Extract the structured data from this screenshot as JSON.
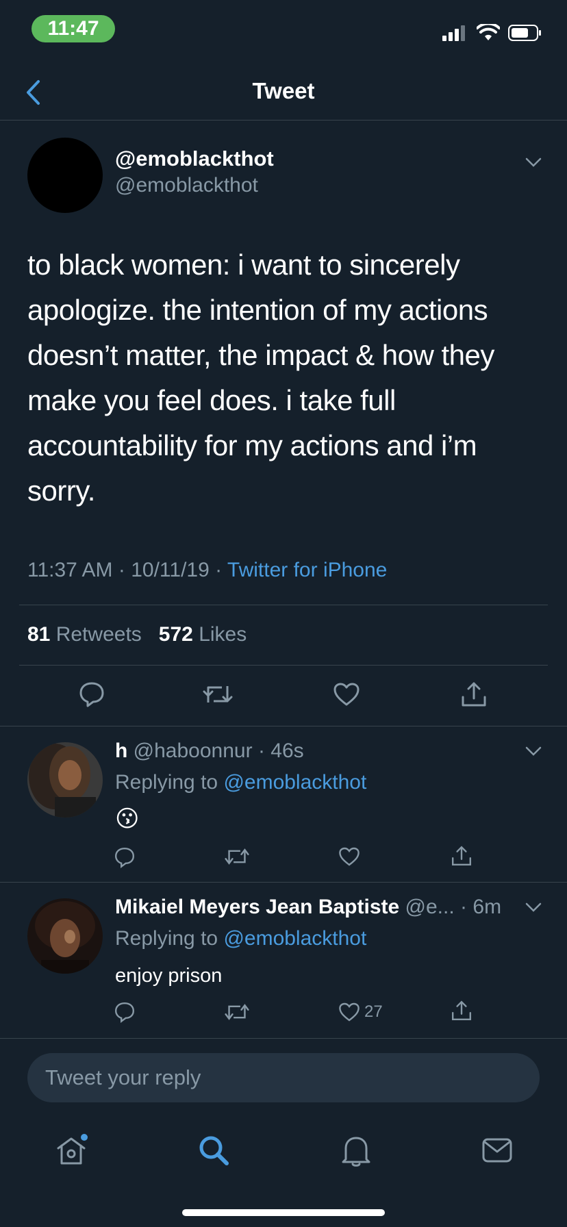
{
  "status_bar": {
    "time": "11:47"
  },
  "header": {
    "title": "Tweet"
  },
  "main_tweet": {
    "display_name": "@emoblackthot",
    "handle": "@emoblackthot",
    "text": "to black women: i want to sincerely apologize. the intention of my actions doesn’t matter, the impact & how they make you feel does. i take full accountability for my actions and i’m sorry.",
    "time": "11:37 AM",
    "date": "10/11/19",
    "separator": "·",
    "source": "Twitter for iPhone",
    "retweets_count": "81",
    "retweets_label": "Retweets",
    "likes_count": "572",
    "likes_label": "Likes"
  },
  "replies": [
    {
      "name": "h",
      "handle": "@haboonnur",
      "time": "46s",
      "replying_label": "Replying to",
      "replying_to": "@emoblackthot",
      "body": "😗",
      "like_count": ""
    },
    {
      "name": "Mikaiel Meyers Jean Baptiste",
      "handle": "@e...",
      "time": "6m",
      "replying_label": "Replying to",
      "replying_to": "@emoblackthot",
      "body": "enjoy prison",
      "like_count": "27"
    }
  ],
  "compose": {
    "placeholder": "Tweet your reply"
  },
  "tabs": [
    "home-icon",
    "search-icon",
    "notifications-icon",
    "messages-icon"
  ],
  "colors": {
    "background": "#15202b",
    "accent": "#4a9cdf",
    "secondary_text": "#8899a6",
    "divider": "#38444d",
    "time_pill": "#5cb85c"
  }
}
